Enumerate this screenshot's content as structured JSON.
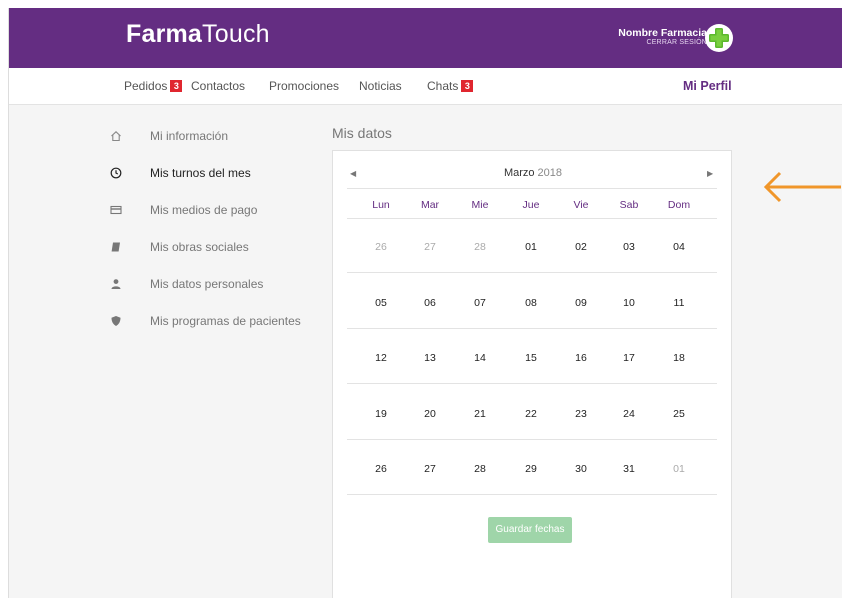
{
  "brand": {
    "bold": "Farma",
    "light": "Touch"
  },
  "header": {
    "pharmacy_name": "Nombre Farmacia",
    "logout_label": "CERRAR SESIÓN",
    "logo_icon": "green-cross-icon"
  },
  "nav": {
    "pedidos": {
      "label": "Pedidos",
      "badge": "3"
    },
    "contactos": {
      "label": "Contactos"
    },
    "promociones": {
      "label": "Promociones"
    },
    "noticias": {
      "label": "Noticias"
    },
    "chats": {
      "label": "Chats",
      "badge": "3"
    },
    "profile": {
      "label": "Mi Perfil"
    }
  },
  "sidebar": {
    "items": [
      {
        "label": "Mi información",
        "icon": "home-icon"
      },
      {
        "label": "Mis turnos del mes",
        "icon": "clock-icon"
      },
      {
        "label": "Mis medios de pago",
        "icon": "credit-card-icon"
      },
      {
        "label": "Mis obras sociales",
        "icon": "book-icon"
      },
      {
        "label": "Mis datos personales",
        "icon": "user-icon"
      },
      {
        "label": "Mis programas de pacientes",
        "icon": "shield-icon"
      }
    ]
  },
  "main": {
    "title": "Mis datos"
  },
  "calendar": {
    "prev": "◀",
    "next": "▶",
    "month": "Marzo",
    "year": "2018",
    "weekdays": [
      "Lun",
      "Mar",
      "Mie",
      "Jue",
      "Vie",
      "Sab",
      "Dom"
    ],
    "weeks": [
      [
        "26",
        "27",
        "28",
        "01",
        "02",
        "03",
        "04"
      ],
      [
        "05",
        "06",
        "07",
        "08",
        "09",
        "10",
        "11"
      ],
      [
        "12",
        "13",
        "14",
        "15",
        "16",
        "17",
        "18"
      ],
      [
        "19",
        "20",
        "21",
        "22",
        "23",
        "24",
        "25"
      ],
      [
        "26",
        "27",
        "28",
        "29",
        "30",
        "31",
        "01"
      ]
    ],
    "muted_days": [
      [
        0,
        0
      ],
      [
        0,
        1
      ],
      [
        0,
        2
      ],
      [
        4,
        6
      ]
    ],
    "save_label": "Guardar fechas"
  },
  "colors": {
    "brand": "#642d82",
    "badge": "#e0262f",
    "button": "#9fd5a9",
    "arrow": "#f0962a"
  }
}
